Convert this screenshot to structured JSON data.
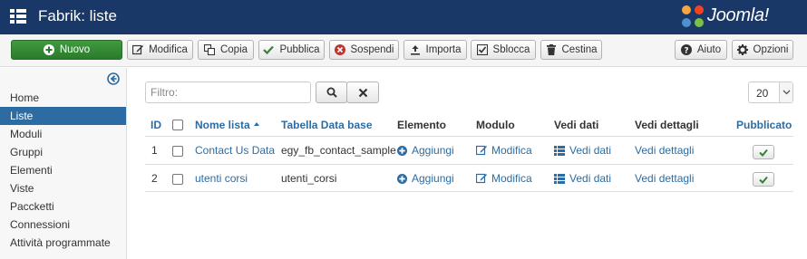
{
  "header": {
    "title": "Fabrik: liste",
    "logo_text": "Joomla!"
  },
  "toolbar": {
    "new_label": "Nuovo",
    "edit_label": "Modifica",
    "copy_label": "Copia",
    "publish_label": "Pubblica",
    "unpublish_label": "Sospendi",
    "import_label": "Importa",
    "checkin_label": "Sblocca",
    "trash_label": "Cestina",
    "help_label": "Aiuto",
    "options_label": "Opzioni"
  },
  "sidebar": {
    "items": [
      {
        "label": "Home",
        "active": false
      },
      {
        "label": "Liste",
        "active": true
      },
      {
        "label": "Moduli",
        "active": false
      },
      {
        "label": "Gruppi",
        "active": false
      },
      {
        "label": "Elementi",
        "active": false
      },
      {
        "label": "Viste",
        "active": false
      },
      {
        "label": "Paccketti",
        "active": false
      },
      {
        "label": "Connessioni",
        "active": false
      },
      {
        "label": "Attività programmate",
        "active": false
      }
    ]
  },
  "filter": {
    "placeholder": "Filtro:",
    "value": "",
    "limit": "20"
  },
  "table": {
    "headers": {
      "id": "ID",
      "name": "Nome lista",
      "db_table": "Tabella Data base",
      "element": "Elemento",
      "form": "Modulo",
      "view_data": "Vedi dati",
      "view_details": "Vedi dettagli",
      "published": "Pubblicato"
    },
    "rows": [
      {
        "id": "1",
        "name": "Contact Us Data",
        "db_table": "egy_fb_contact_sample",
        "element": "Aggiungi",
        "form": "Modifica",
        "view_data": "Vedi dati",
        "view_details": "Vedi dettagli"
      },
      {
        "id": "2",
        "name": "utenti corsi",
        "db_table": "utenti_corsi",
        "element": "Aggiungi",
        "form": "Modifica",
        "view_data": "Vedi dati",
        "view_details": "Vedi dettagli"
      }
    ]
  },
  "colors": {
    "header_bg": "#1a3867",
    "link": "#2d6ca2",
    "primary_green": "#2c7a2c",
    "active_nav": "#2d6ca2"
  },
  "icons": [
    "menu-grid-icon",
    "joomla-logo-icon",
    "plus-circle-icon",
    "edit-icon",
    "copy-icon",
    "check-icon",
    "cancel-circle-icon",
    "upload-icon",
    "checkbox-icon",
    "trash-icon",
    "question-icon",
    "gear-icon",
    "arrow-left-circle-icon",
    "search-icon",
    "close-icon",
    "list-icon"
  ]
}
